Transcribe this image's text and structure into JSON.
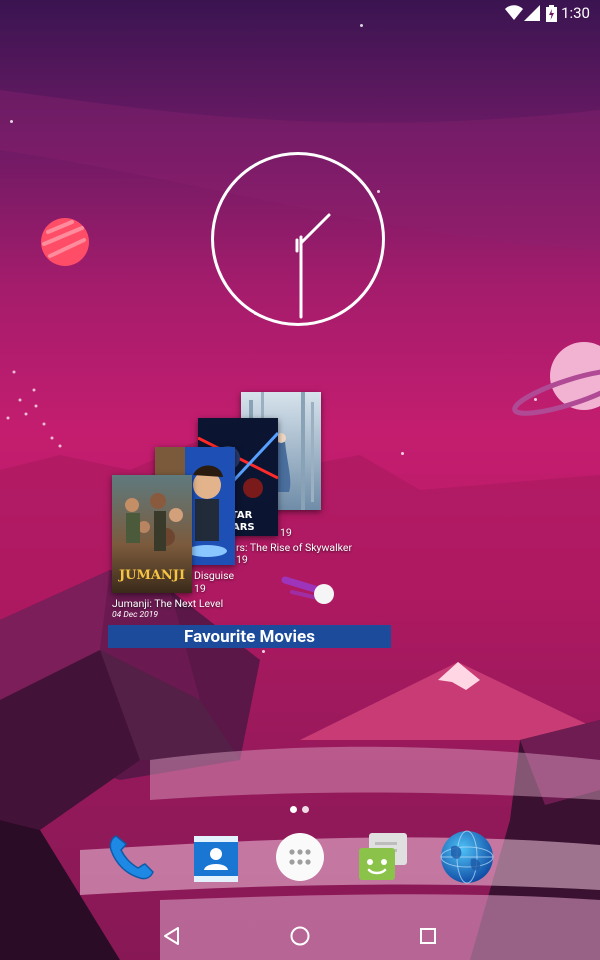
{
  "status_bar": {
    "time": "1:30"
  },
  "clock_widget": {
    "hour_hand_angle_deg": 45,
    "minute_hand_angle_deg": 180
  },
  "movies_widget": {
    "movies": [
      {
        "title": "Jumanji: The Next Level",
        "date": "04 Dec 2019"
      },
      {
        "title_partial": "Disguise",
        "date_partial": "19"
      },
      {
        "title_partial": "rs: The Rise of Skywalker",
        "date_partial": "19"
      },
      {
        "date_partial": "19"
      }
    ],
    "banner_label": "Favourite Movies",
    "banner_color": "#1b4b9a"
  },
  "home_page_indicator": {
    "pages": 2,
    "current": 1
  },
  "dock": {
    "apps": [
      "phone",
      "contacts",
      "app-drawer",
      "messaging",
      "browser"
    ]
  },
  "navigation_bar": {
    "buttons": [
      "back",
      "home",
      "recents"
    ]
  }
}
